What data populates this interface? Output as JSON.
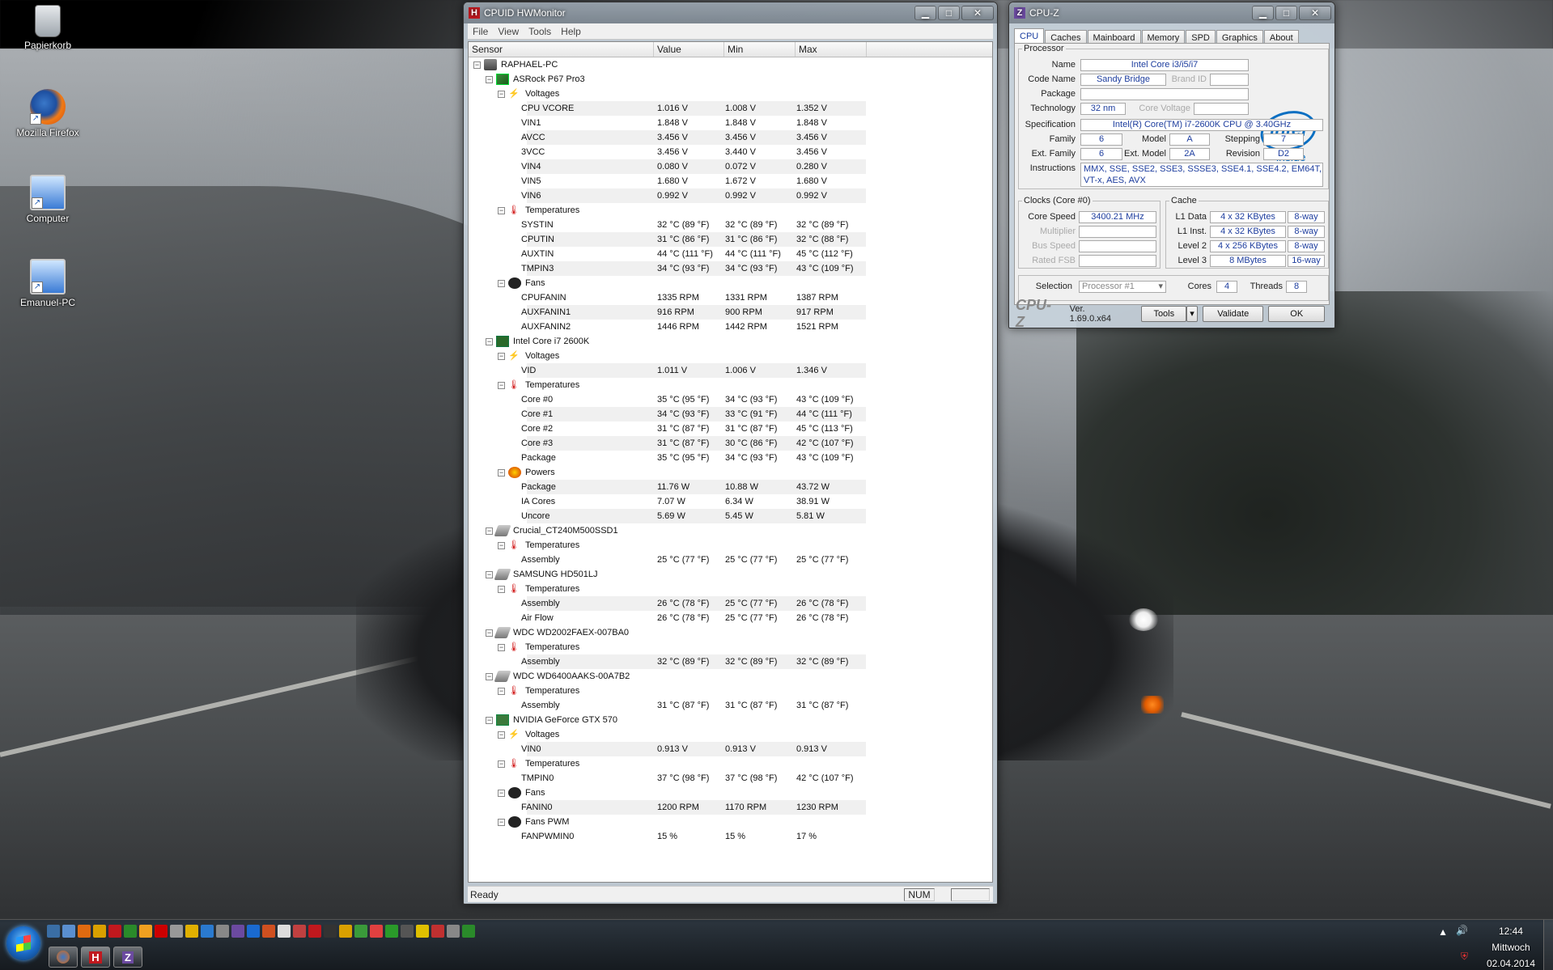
{
  "desktop": {
    "icons": [
      {
        "label": "Papierkorb",
        "icon": "recycle-bin-icon"
      },
      {
        "label": "Mozilla Firefox",
        "icon": "firefox-icon"
      },
      {
        "label": "Computer",
        "icon": "computer-icon"
      },
      {
        "label": "Emanuel-PC",
        "icon": "network-computer-icon"
      }
    ]
  },
  "hwmonitor": {
    "title": "CPUID HWMonitor",
    "app_icon": "H",
    "menu": [
      "File",
      "View",
      "Tools",
      "Help"
    ],
    "columns": [
      "Sensor",
      "Value",
      "Min",
      "Max"
    ],
    "rows": [
      {
        "level": 0,
        "label": "RAPHAEL-PC",
        "icon": "pc-icon",
        "kind": "node"
      },
      {
        "level": 1,
        "label": "ASRock P67 Pro3",
        "icon": "motherboard-icon",
        "kind": "node"
      },
      {
        "level": 2,
        "label": "Voltages",
        "icon": "voltage-icon",
        "kind": "node"
      },
      {
        "level": 3,
        "label": "CPU VCORE",
        "value": "1.016 V",
        "min": "1.008 V",
        "max": "1.352 V",
        "kind": "leaf"
      },
      {
        "level": 3,
        "label": "VIN1",
        "value": "1.848 V",
        "min": "1.848 V",
        "max": "1.848 V",
        "kind": "leaf"
      },
      {
        "level": 3,
        "label": "AVCC",
        "value": "3.456 V",
        "min": "3.456 V",
        "max": "3.456 V",
        "kind": "leaf"
      },
      {
        "level": 3,
        "label": "3VCC",
        "value": "3.456 V",
        "min": "3.440 V",
        "max": "3.456 V",
        "kind": "leaf"
      },
      {
        "level": 3,
        "label": "VIN4",
        "value": "0.080 V",
        "min": "0.072 V",
        "max": "0.280 V",
        "kind": "leaf"
      },
      {
        "level": 3,
        "label": "VIN5",
        "value": "1.680 V",
        "min": "1.672 V",
        "max": "1.680 V",
        "kind": "leaf"
      },
      {
        "level": 3,
        "label": "VIN6",
        "value": "0.992 V",
        "min": "0.992 V",
        "max": "0.992 V",
        "kind": "leaf"
      },
      {
        "level": 2,
        "label": "Temperatures",
        "icon": "thermometer-icon",
        "kind": "node"
      },
      {
        "level": 3,
        "label": "SYSTIN",
        "value": "32 °C  (89 °F)",
        "min": "32 °C  (89 °F)",
        "max": "32 °C  (89 °F)",
        "kind": "leaf"
      },
      {
        "level": 3,
        "label": "CPUTIN",
        "value": "31 °C  (86 °F)",
        "min": "31 °C  (86 °F)",
        "max": "32 °C  (88 °F)",
        "kind": "leaf"
      },
      {
        "level": 3,
        "label": "AUXTIN",
        "value": "44 °C  (111 °F)",
        "min": "44 °C  (111 °F)",
        "max": "45 °C  (112 °F)",
        "kind": "leaf"
      },
      {
        "level": 3,
        "label": "TMPIN3",
        "value": "34 °C  (93 °F)",
        "min": "34 °C  (93 °F)",
        "max": "43 °C  (109 °F)",
        "kind": "leaf"
      },
      {
        "level": 2,
        "label": "Fans",
        "icon": "fan-icon",
        "kind": "node"
      },
      {
        "level": 3,
        "label": "CPUFANIN",
        "value": "1335 RPM",
        "min": "1331 RPM",
        "max": "1387 RPM",
        "kind": "leaf"
      },
      {
        "level": 3,
        "label": "AUXFANIN1",
        "value": "916 RPM",
        "min": "900 RPM",
        "max": "917 RPM",
        "kind": "leaf"
      },
      {
        "level": 3,
        "label": "AUXFANIN2",
        "value": "1446 RPM",
        "min": "1442 RPM",
        "max": "1521 RPM",
        "kind": "leaf"
      },
      {
        "level": 1,
        "label": "Intel Core i7 2600K",
        "icon": "cpu-icon",
        "kind": "node"
      },
      {
        "level": 2,
        "label": "Voltages",
        "icon": "voltage-icon",
        "kind": "node"
      },
      {
        "level": 3,
        "label": "VID",
        "value": "1.011 V",
        "min": "1.006 V",
        "max": "1.346 V",
        "kind": "leaf"
      },
      {
        "level": 2,
        "label": "Temperatures",
        "icon": "thermometer-icon",
        "kind": "node"
      },
      {
        "level": 3,
        "label": "Core #0",
        "value": "35 °C  (95 °F)",
        "min": "34 °C  (93 °F)",
        "max": "43 °C  (109 °F)",
        "kind": "leaf"
      },
      {
        "level": 3,
        "label": "Core #1",
        "value": "34 °C  (93 °F)",
        "min": "33 °C  (91 °F)",
        "max": "44 °C  (111 °F)",
        "kind": "leaf"
      },
      {
        "level": 3,
        "label": "Core #2",
        "value": "31 °C  (87 °F)",
        "min": "31 °C  (87 °F)",
        "max": "45 °C  (113 °F)",
        "kind": "leaf"
      },
      {
        "level": 3,
        "label": "Core #3",
        "value": "31 °C  (87 °F)",
        "min": "30 °C  (86 °F)",
        "max": "42 °C  (107 °F)",
        "kind": "leaf"
      },
      {
        "level": 3,
        "label": "Package",
        "value": "35 °C  (95 °F)",
        "min": "34 °C  (93 °F)",
        "max": "43 °C  (109 °F)",
        "kind": "leaf"
      },
      {
        "level": 2,
        "label": "Powers",
        "icon": "power-icon",
        "kind": "node"
      },
      {
        "level": 3,
        "label": "Package",
        "value": "11.76 W",
        "min": "10.88 W",
        "max": "43.72 W",
        "kind": "leaf"
      },
      {
        "level": 3,
        "label": "IA Cores",
        "value": "7.07 W",
        "min": "6.34 W",
        "max": "38.91 W",
        "kind": "leaf"
      },
      {
        "level": 3,
        "label": "Uncore",
        "value": "5.69 W",
        "min": "5.45 W",
        "max": "5.81 W",
        "kind": "leaf"
      },
      {
        "level": 1,
        "label": "Crucial_CT240M500SSD1",
        "icon": "drive-icon",
        "kind": "node"
      },
      {
        "level": 2,
        "label": "Temperatures",
        "icon": "thermometer-icon",
        "kind": "node"
      },
      {
        "level": 3,
        "label": "Assembly",
        "value": "25 °C  (77 °F)",
        "min": "25 °C  (77 °F)",
        "max": "25 °C  (77 °F)",
        "kind": "leaf"
      },
      {
        "level": 1,
        "label": "SAMSUNG HD501LJ",
        "icon": "drive-icon",
        "kind": "node"
      },
      {
        "level": 2,
        "label": "Temperatures",
        "icon": "thermometer-icon",
        "kind": "node"
      },
      {
        "level": 3,
        "label": "Assembly",
        "value": "26 °C  (78 °F)",
        "min": "25 °C  (77 °F)",
        "max": "26 °C  (78 °F)",
        "kind": "leaf"
      },
      {
        "level": 3,
        "label": "Air Flow",
        "value": "26 °C  (78 °F)",
        "min": "25 °C  (77 °F)",
        "max": "26 °C  (78 °F)",
        "kind": "leaf"
      },
      {
        "level": 1,
        "label": "WDC WD2002FAEX-007BA0",
        "icon": "drive-icon",
        "kind": "node"
      },
      {
        "level": 2,
        "label": "Temperatures",
        "icon": "thermometer-icon",
        "kind": "node"
      },
      {
        "level": 3,
        "label": "Assembly",
        "value": "32 °C  (89 °F)",
        "min": "32 °C  (89 °F)",
        "max": "32 °C  (89 °F)",
        "kind": "leaf"
      },
      {
        "level": 1,
        "label": "WDC WD6400AAKS-00A7B2",
        "icon": "drive-icon",
        "kind": "node"
      },
      {
        "level": 2,
        "label": "Temperatures",
        "icon": "thermometer-icon",
        "kind": "node"
      },
      {
        "level": 3,
        "label": "Assembly",
        "value": "31 °C  (87 °F)",
        "min": "31 °C  (87 °F)",
        "max": "31 °C  (87 °F)",
        "kind": "leaf"
      },
      {
        "level": 1,
        "label": "NVIDIA GeForce GTX 570",
        "icon": "gpu-icon",
        "kind": "node"
      },
      {
        "level": 2,
        "label": "Voltages",
        "icon": "voltage-icon",
        "kind": "node"
      },
      {
        "level": 3,
        "label": "VIN0",
        "value": "0.913 V",
        "min": "0.913 V",
        "max": "0.913 V",
        "kind": "leaf"
      },
      {
        "level": 2,
        "label": "Temperatures",
        "icon": "thermometer-icon",
        "kind": "node"
      },
      {
        "level": 3,
        "label": "TMPIN0",
        "value": "37 °C  (98 °F)",
        "min": "37 °C  (98 °F)",
        "max": "42 °C  (107 °F)",
        "kind": "leaf"
      },
      {
        "level": 2,
        "label": "Fans",
        "icon": "fan-icon",
        "kind": "node"
      },
      {
        "level": 3,
        "label": "FANIN0",
        "value": "1200 RPM",
        "min": "1170 RPM",
        "max": "1230 RPM",
        "kind": "leaf"
      },
      {
        "level": 2,
        "label": "Fans PWM",
        "icon": "fan-pwm-icon",
        "kind": "node"
      },
      {
        "level": 3,
        "label": "FANPWMIN0",
        "value": "15 %",
        "min": "15 %",
        "max": "17 %",
        "kind": "leaf"
      }
    ],
    "status": "Ready",
    "num": "NUM"
  },
  "cpuz": {
    "title": "CPU-Z",
    "app_icon": "Z",
    "tabs": [
      "CPU",
      "Caches",
      "Mainboard",
      "Memory",
      "SPD",
      "Graphics",
      "About"
    ],
    "active_tab": "CPU",
    "processor": {
      "legend": "Processor",
      "name_label": "Name",
      "name": "Intel Core i3/i5/i7",
      "codename_label": "Code Name",
      "codename": "Sandy Bridge",
      "brandid_label": "Brand ID",
      "brandid": "",
      "package_label": "Package",
      "package": "",
      "technology_label": "Technology",
      "technology": "32 nm",
      "corevoltage_label": "Core Voltage",
      "corevoltage": "",
      "spec_label": "Specification",
      "spec": "Intel(R) Core(TM) i7-2600K CPU @ 3.40GHz",
      "family_label": "Family",
      "family": "6",
      "model_label": "Model",
      "model": "A",
      "stepping_label": "Stepping",
      "stepping": "7",
      "extfamily_label": "Ext. Family",
      "extfamily": "6",
      "extmodel_label": "Ext. Model",
      "extmodel": "2A",
      "revision_label": "Revision",
      "revision": "D2",
      "instructions_label": "Instructions",
      "instructions_1": "MMX, SSE, SSE2, SSE3, SSSE3, SSE4.1, SSE4.2, EM64T,",
      "instructions_2": "VT-x, AES, AVX",
      "logo_word": "intel",
      "logo_sub": "inside"
    },
    "clocks": {
      "legend": "Clocks (Core #0)",
      "corespeed_label": "Core Speed",
      "corespeed": "3400.21 MHz",
      "multiplier_label": "Multiplier",
      "multiplier": "",
      "busspeed_label": "Bus Speed",
      "busspeed": "",
      "ratedfsb_label": "Rated FSB",
      "ratedfsb": ""
    },
    "cache": {
      "legend": "Cache",
      "l1d_label": "L1 Data",
      "l1d": "4 x 32 KBytes",
      "l1d_way": "8-way",
      "l1i_label": "L1 Inst.",
      "l1i": "4 x 32 KBytes",
      "l1i_way": "8-way",
      "l2_label": "Level 2",
      "l2": "4 x 256 KBytes",
      "l2_way": "8-way",
      "l3_label": "Level 3",
      "l3": "8 MBytes",
      "l3_way": "16-way"
    },
    "selection": {
      "label": "Selection",
      "value": "Processor #1",
      "cores_label": "Cores",
      "cores": "4",
      "threads_label": "Threads",
      "threads": "8"
    },
    "footer": {
      "logo": "CPU-Z",
      "version": "Ver. 1.69.0.x64",
      "tools": "Tools",
      "validate": "Validate",
      "ok": "OK"
    }
  },
  "taskbar": {
    "clock_time": "12:44",
    "clock_day": "Mittwoch",
    "clock_date": "02.04.2014",
    "tasks": [
      {
        "label": "",
        "icon": "firefox-icon"
      },
      {
        "label": "H",
        "icon": "hwmonitor-icon"
      },
      {
        "label": "Z",
        "icon": "cpuz-icon"
      }
    ]
  }
}
